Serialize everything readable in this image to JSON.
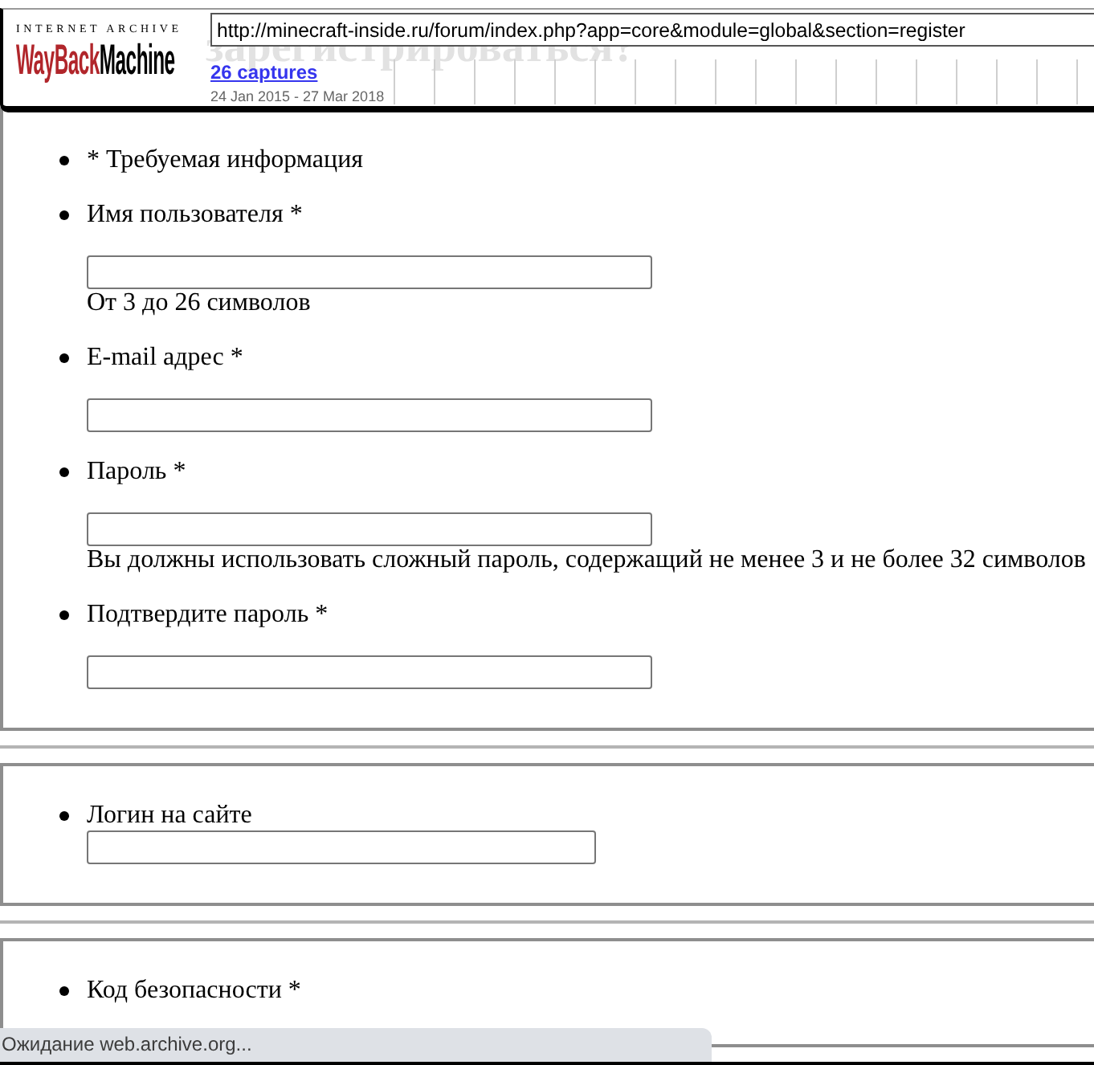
{
  "toolbar": {
    "logo": {
      "caption": "INTERNET ARCHIVE",
      "wordmark": [
        "WayBack",
        "Machine"
      ]
    },
    "url": "http://minecraft-inside.ru/forum/index.php?app=core&module=global&section=register",
    "captures_link": "26 captures",
    "date_range": "24 Jan 2015 - 27 Mar 2018"
  },
  "page_heading": "зарегистрироваться?",
  "sections": [
    {
      "items": [
        {
          "kind": "note",
          "text": "* Требуемая информация"
        },
        {
          "kind": "field",
          "label": "Имя пользователя *",
          "help": "От 3 до 26 символов"
        },
        {
          "kind": "field",
          "label": "E-mail адрес *"
        },
        {
          "kind": "field",
          "label": "Пароль *",
          "help": "Вы должны использовать сложный пароль, содержащий не менее 3 и не более 32 символов"
        },
        {
          "kind": "field",
          "label": "Подтвердите пароль *"
        }
      ]
    },
    {
      "items": [
        {
          "kind": "field_compact",
          "label": "Логин на сайте"
        }
      ]
    },
    {
      "items": [
        {
          "kind": "note",
          "text": "Код безопасности *"
        }
      ]
    }
  ],
  "status_bar": "Ожидание web.archive.org..."
}
